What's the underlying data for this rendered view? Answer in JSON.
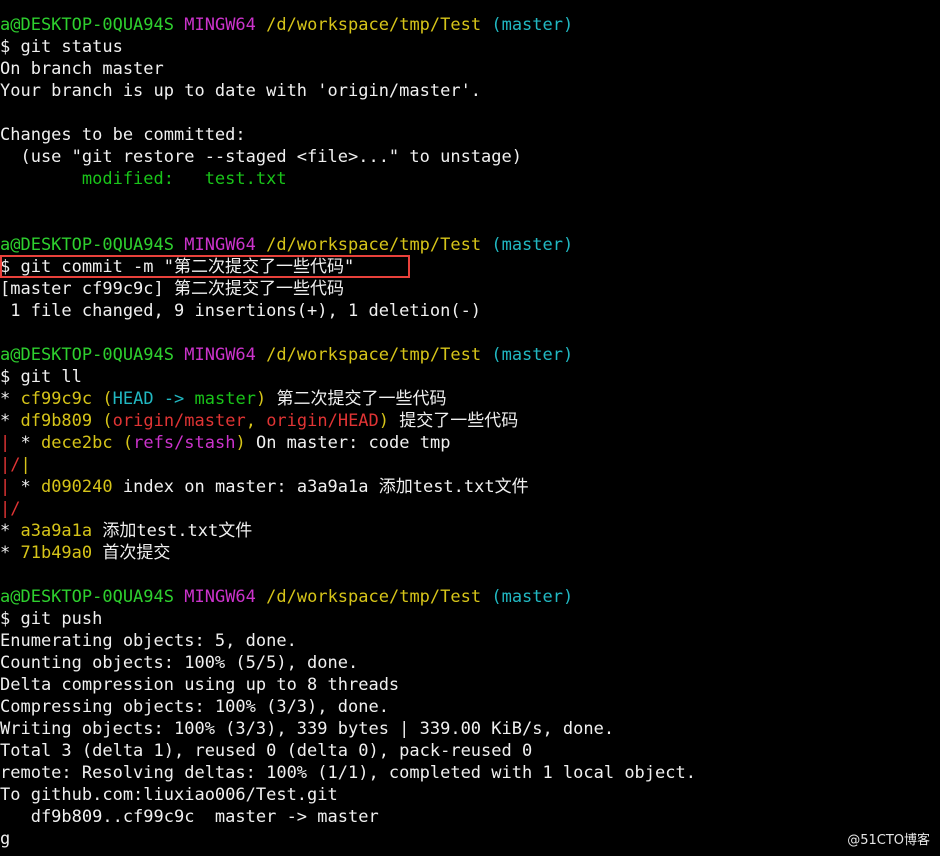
{
  "prompt": {
    "user_host": "a@DESKTOP-0QUA94S",
    "shell": "MINGW64",
    "path": "/d/workspace/tmp/Test",
    "branch": "(master)"
  },
  "blocks": [
    {
      "command": "$ git status",
      "output": [
        "On branch master",
        "Your branch is up to date with 'origin/master'.",
        "",
        "Changes to be committed:",
        "  (use \"git restore --staged <file>...\" to unstage)"
      ],
      "modified_label": "        modified:   test.txt"
    },
    {
      "command": "$ git commit -m \"第二次提交了一些代码\"",
      "output": [
        "[master cf99c9c] 第二次提交了一些代码",
        " 1 file changed, 9 insertions(+), 1 deletion(-)"
      ]
    },
    {
      "command": "$ git ll",
      "log": {
        "l1": {
          "star": "* ",
          "hash": "cf99c9c",
          "sp": " ",
          "lp": "(",
          "head": "HEAD -> ",
          "ref": "master",
          "rp": ")",
          "msg": " 第二次提交了一些代码"
        },
        "l2": {
          "star": "* ",
          "hash": "df9b809",
          "sp": " ",
          "lp": "(",
          "ref1": "origin/master",
          "comma": ", ",
          "ref2": "origin/HEAD",
          "rp": ")",
          "msg": " 提交了一些代码"
        },
        "l3": {
          "bar": "|",
          "star": " * ",
          "hash": "dece2bc",
          "sp": " ",
          "lp": "(",
          "ref": "refs/stash",
          "rp": ")",
          "msg": " On master: code tmp"
        },
        "l4": {
          "bar": "|/",
          "bar2": "|"
        },
        "l5": {
          "bar": "|",
          "star": " * ",
          "hash": "d090240",
          "msg": " index on master: a3a9a1a 添加test.txt文件"
        },
        "l6": {
          "bar": "|/"
        },
        "l7": {
          "star": "* ",
          "hash": "a3a9a1a",
          "msg": " 添加test.txt文件"
        },
        "l8": {
          "star": "* ",
          "hash": "71b49a0",
          "msg": " 首次提交"
        }
      }
    },
    {
      "command": "$ git push",
      "output": [
        "Enumerating objects: 5, done.",
        "Counting objects: 100% (5/5), done.",
        "Delta compression using up to 8 threads",
        "Compressing objects: 100% (3/3), done.",
        "Writing objects: 100% (3/3), 339 bytes | 339.00 KiB/s, done.",
        "Total 3 (delta 1), reused 0 (delta 0), pack-reused 0",
        "remote: Resolving deltas: 100% (1/1), completed with 1 local object.",
        "To github.com:liuxiao006/Test.git",
        "   df9b809..cf99c9c  master -> master",
        "g"
      ]
    }
  ],
  "watermark": "@51CTO博客",
  "colors": {
    "background": "#000000",
    "user_host": "#2ed02e",
    "shell": "#cc33cc",
    "path": "#d6c419",
    "branch": "#21b8c2",
    "highlight_box": "#e8413b"
  }
}
